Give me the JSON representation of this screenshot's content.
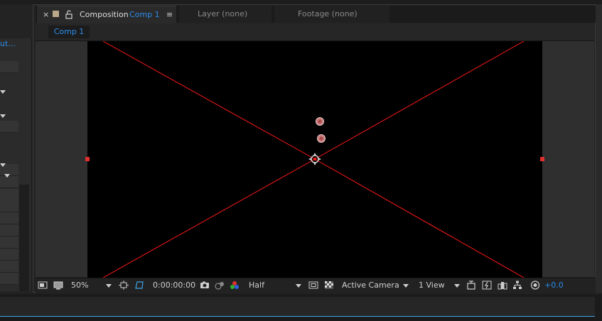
{
  "left_panel": {
    "tab_label": "ut..."
  },
  "tabs": {
    "close": "×",
    "composition_label": "Composition",
    "composition_name": "Comp 1",
    "menu": "≡",
    "layer": "Layer (none)",
    "footage": "Footage (none)"
  },
  "subtab": {
    "label": "Comp 1"
  },
  "toolbar": {
    "zoom": "50%",
    "timecode": "0:00:00:00",
    "resolution": "Half",
    "camera": "Active Camera",
    "views": "1 View",
    "exposure": "+0.0"
  },
  "colors": {
    "accent": "#2d8ceb",
    "guide_red": "#ff1a1a",
    "canvas": "#000000"
  },
  "icons": [
    "always-preview-icon",
    "monitor-icon",
    "dropdown-arrow-icon",
    "region-of-interest-icon",
    "transparency-grid-icon",
    "camera-snapshot-icon",
    "show-snapshot-icon",
    "color-channels-icon",
    "fast-previews-icon",
    "draft-3d-icon",
    "toggle-mask-icon",
    "flowchart-icon",
    "exposure-reset-icon"
  ]
}
